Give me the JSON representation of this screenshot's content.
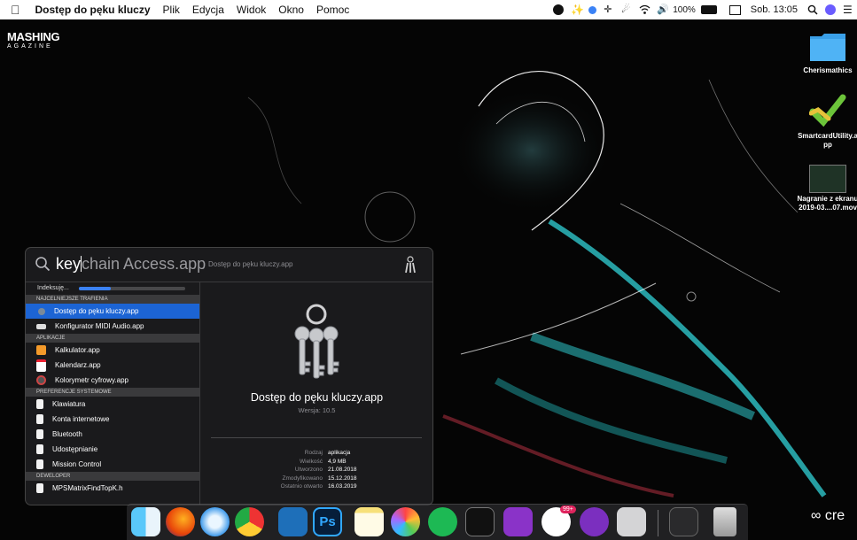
{
  "menubar": {
    "app_name": "Dostęp do pęku kluczy",
    "menus": [
      "Plik",
      "Edycja",
      "Widok",
      "Okno",
      "Pomoc"
    ],
    "battery": "100%",
    "clock": "Sob. 13:05"
  },
  "wallpaper_brand": {
    "title": "MASHING",
    "subtitle": "AGAZINE"
  },
  "desktop": {
    "icons": [
      {
        "name": "Cherismathics",
        "icon": "folder-icon"
      },
      {
        "name": "SmartcardUtility.app",
        "line1": "SmartcardUtility.a",
        "line2": "pp",
        "icon": "checkmark-app-icon"
      },
      {
        "name": "Nagranie z ekranu 2019-03....07.mov",
        "line1": "Nagranie z ekranu",
        "line2": "2019-03....07.mov",
        "icon": "video-thumbnail-icon"
      }
    ]
  },
  "spotlight": {
    "query": "key",
    "suggestion": "chain Access.app",
    "hint": "Dostęp do pęku kluczy.app",
    "indexing_label": "Indeksuję...",
    "indexing_progress": 0.3,
    "sections": {
      "top": "NAJCELNIEJSZE TRAFIENIA",
      "apps": "APLIKACJE",
      "prefs": "PREFERENCJE SYSTEMOWE",
      "dev": "DEWELOPER"
    },
    "results": {
      "top": [
        {
          "label": "Dostęp do pęku kluczy.app",
          "icon": "keychain-icon",
          "selected": true
        },
        {
          "label": "Konfigurator MIDI Audio.app",
          "icon": "midi-keyboard-icon"
        }
      ],
      "apps": [
        {
          "label": "Kalkulator.app",
          "icon": "calculator-icon"
        },
        {
          "label": "Kalendarz.app",
          "icon": "calendar-icon"
        },
        {
          "label": "Kolorymetr cyfrowy.app",
          "icon": "colorimeter-icon"
        }
      ],
      "prefs": [
        {
          "label": "Klawiatura",
          "icon": "document-icon"
        },
        {
          "label": "Konta internetowe",
          "icon": "document-icon"
        },
        {
          "label": "Bluetooth",
          "icon": "document-icon"
        },
        {
          "label": "Udostępnianie",
          "icon": "document-icon"
        },
        {
          "label": "Mission Control",
          "icon": "document-icon"
        }
      ],
      "dev": [
        {
          "label": "MPSMatrixFindTopK.h",
          "icon": "header-file-icon"
        }
      ]
    },
    "preview": {
      "title": "Dostęp do pęku kluczy.app",
      "version": "Wersja: 10.5",
      "meta": [
        {
          "key": "Rodzaj",
          "value": "aplikacja"
        },
        {
          "key": "Wielkość",
          "value": "4,9 MB"
        },
        {
          "key": "Utworzono",
          "value": "21.08.2018"
        },
        {
          "key": "Zmodyfikowano",
          "value": "15.12.2018"
        },
        {
          "key": "Ostatnio otwarto",
          "value": "16.03.2019"
        }
      ]
    }
  },
  "dock": {
    "apps": [
      "Finder",
      "Firefox",
      "Safari",
      "Chrome",
      "Visual Studio Code",
      "Photoshop",
      "Notes",
      "Photos",
      "Spotify",
      "Terminal",
      "RP",
      "Messenger",
      "GOG Galaxy",
      "Keychain Access",
      "Screen recording",
      "Trash"
    ],
    "badge": "99+"
  },
  "watermark": "cre",
  "colors": {
    "selection": "#1c64d4",
    "accent_teal": "#2ec4c9",
    "progress": "#3b82f6"
  }
}
